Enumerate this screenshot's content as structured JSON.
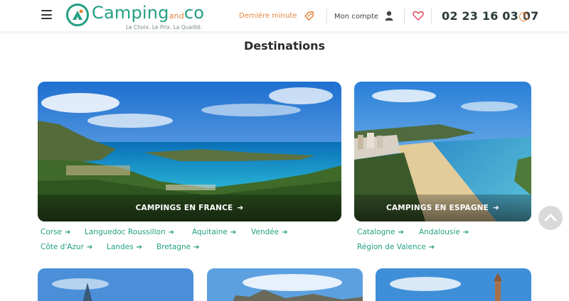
{
  "header": {
    "logo_main": "Camping",
    "logo_and": "and",
    "logo_co": "co",
    "tagline": "Le Choix. Le Prix. La Qualité.",
    "last_minute": "Dernière minute",
    "account": "Mon compte",
    "phone": "02 23 16 03 07",
    "info_glyph": "i"
  },
  "section": {
    "title": "Destinations"
  },
  "cards": [
    {
      "label": "CAMPINGS EN FRANCE",
      "arrow": "➔",
      "links": [
        "Corse",
        "Languedoc Roussillon",
        "Aquitaine",
        "Vendée",
        "Côte d'Azur",
        "Landes",
        "Bretagne"
      ]
    },
    {
      "label": "CAMPINGS EN ESPAGNE",
      "arrow": "➔",
      "links": [
        "Catalogne",
        "Andalousie",
        "Région de Valence"
      ]
    }
  ],
  "link_arrow": "➔",
  "scroll_top_glyph": "⌃",
  "colors": {
    "brand_green": "#23a084",
    "accent_orange": "#e5833c",
    "heart_pink": "#e0405a"
  },
  "icons": [
    "menu-icon",
    "tag-icon",
    "user-icon",
    "heart-icon",
    "info-icon",
    "arrow-right-icon",
    "chevron-up-icon"
  ]
}
